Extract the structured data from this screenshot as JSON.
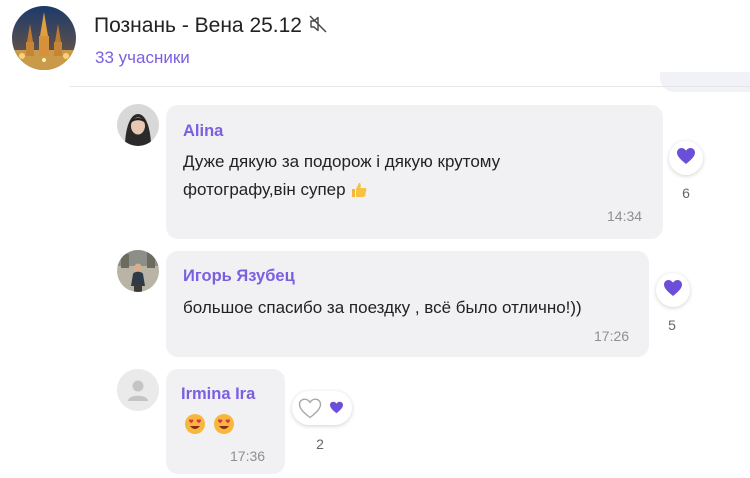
{
  "chat": {
    "title": "Познань - Вена 25.12",
    "members": "33 учасники"
  },
  "messages": [
    {
      "author": "Alina",
      "line1": "Дуже дякую за подорож і дякую крутому",
      "line2": "фотографу,він супер",
      "time": "14:34",
      "likes": "6"
    },
    {
      "author": "Игорь Язубец",
      "line1": "большое спасибо за поездку , всё было отлично!))",
      "time": "17:26",
      "likes": "5"
    },
    {
      "author": "Irmina Ira",
      "time": "17:36",
      "likes": "2"
    }
  ],
  "colors": {
    "accent": "#7b5fe0",
    "bubble": "#f1f1f3",
    "heart": "#6c4fd8"
  },
  "icons": [
    "mute-icon",
    "thumbs-up-emoji",
    "heart-eyes-emoji",
    "heart-icon",
    "heart-outline-icon",
    "default-avatar-icon"
  ]
}
